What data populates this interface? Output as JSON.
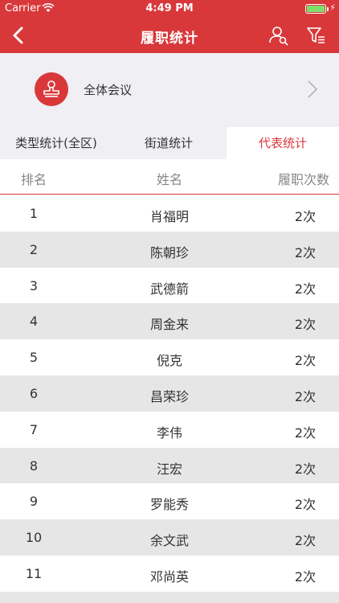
{
  "status_bar": {
    "carrier": "Carrier",
    "time": "4:49 PM",
    "icons": [
      "wifi-icon",
      "battery-icon",
      "charging-bolt-icon"
    ]
  },
  "nav": {
    "title": "履职统计",
    "icons": [
      "back-chevron-icon",
      "person-search-icon",
      "filter-icon"
    ]
  },
  "meeting": {
    "label": "全体会议",
    "icon": "stamp-icon"
  },
  "tabs": [
    {
      "label": "类型统计(全区)",
      "active": false
    },
    {
      "label": "街道统计",
      "active": false
    },
    {
      "label": "代表统计",
      "active": true
    }
  ],
  "table": {
    "headers": [
      "排名",
      "姓名",
      "履职次数"
    ],
    "rows": [
      {
        "rank": "1",
        "name": "肖福明",
        "count": "2次"
      },
      {
        "rank": "2",
        "name": "陈朝珍",
        "count": "2次"
      },
      {
        "rank": "3",
        "name": "武德箭",
        "count": "2次"
      },
      {
        "rank": "4",
        "name": "周金来",
        "count": "2次"
      },
      {
        "rank": "5",
        "name": "倪克",
        "count": "2次"
      },
      {
        "rank": "6",
        "name": "昌荣珍",
        "count": "2次"
      },
      {
        "rank": "7",
        "name": "李伟",
        "count": "2次"
      },
      {
        "rank": "8",
        "name": "汪宏",
        "count": "2次"
      },
      {
        "rank": "9",
        "name": "罗能秀",
        "count": "2次"
      },
      {
        "rank": "10",
        "name": "余文武",
        "count": "2次"
      },
      {
        "rank": "11",
        "name": "邓尚英",
        "count": "2次"
      }
    ]
  },
  "colors": {
    "accent": "#d9383b",
    "background_gray": "#efeff4",
    "stripe": "#e6e6e6"
  }
}
